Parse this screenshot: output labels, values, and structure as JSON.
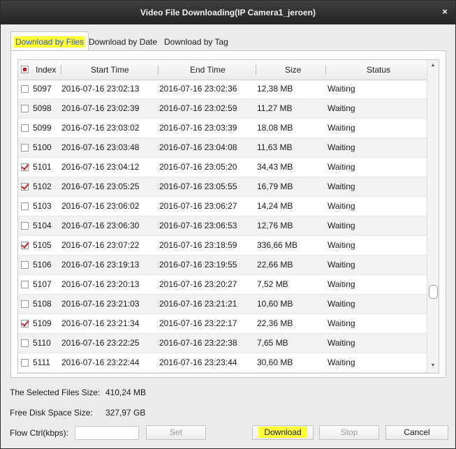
{
  "window": {
    "title": "Video File Downloading(IP Camera1_jeroen)",
    "close_glyph": "×"
  },
  "tabs": [
    {
      "label": "Download by Files",
      "active": true
    },
    {
      "label": "Download by Date",
      "active": false
    },
    {
      "label": "Download by Tag",
      "active": false
    }
  ],
  "table": {
    "columns": [
      "Index",
      "Start Time",
      "End Time",
      "Size",
      "Status"
    ],
    "select_all_state": "partial",
    "rows": [
      {
        "checked": false,
        "index": "5097",
        "start": "2016-07-16 23:02:13",
        "end": "2016-07-16 23:02:36",
        "size": "12,38 MB",
        "status": "Waiting"
      },
      {
        "checked": false,
        "index": "5098",
        "start": "2016-07-16 23:02:39",
        "end": "2016-07-16 23:02:59",
        "size": "11,27 MB",
        "status": "Waiting"
      },
      {
        "checked": false,
        "index": "5099",
        "start": "2016-07-16 23:03:02",
        "end": "2016-07-16 23:03:39",
        "size": "18,08 MB",
        "status": "Waiting"
      },
      {
        "checked": false,
        "index": "5100",
        "start": "2016-07-16 23:03:48",
        "end": "2016-07-16 23:04:08",
        "size": "11,63 MB",
        "status": "Waiting"
      },
      {
        "checked": true,
        "index": "5101",
        "start": "2016-07-16 23:04:12",
        "end": "2016-07-16 23:05:20",
        "size": "34,43 MB",
        "status": "Waiting"
      },
      {
        "checked": true,
        "index": "5102",
        "start": "2016-07-16 23:05:25",
        "end": "2016-07-16 23:05:55",
        "size": "16,79 MB",
        "status": "Waiting"
      },
      {
        "checked": false,
        "index": "5103",
        "start": "2016-07-16 23:06:02",
        "end": "2016-07-16 23:06:27",
        "size": "14,24 MB",
        "status": "Waiting"
      },
      {
        "checked": false,
        "index": "5104",
        "start": "2016-07-16 23:06:30",
        "end": "2016-07-16 23:06:53",
        "size": "12,76 MB",
        "status": "Waiting"
      },
      {
        "checked": true,
        "index": "5105",
        "start": "2016-07-16 23:07:22",
        "end": "2016-07-16 23:18:59",
        "size": "336,66 MB",
        "status": "Waiting"
      },
      {
        "checked": false,
        "index": "5106",
        "start": "2016-07-16 23:19:13",
        "end": "2016-07-16 23:19:55",
        "size": "22,66 MB",
        "status": "Waiting"
      },
      {
        "checked": false,
        "index": "5107",
        "start": "2016-07-16 23:20:13",
        "end": "2016-07-16 23:20:27",
        "size": "7,52 MB",
        "status": "Waiting"
      },
      {
        "checked": false,
        "index": "5108",
        "start": "2016-07-16 23:21:03",
        "end": "2016-07-16 23:21:21",
        "size": "10,60 MB",
        "status": "Waiting"
      },
      {
        "checked": true,
        "index": "5109",
        "start": "2016-07-16 23:21:34",
        "end": "2016-07-16 23:22:17",
        "size": "22,36 MB",
        "status": "Waiting"
      },
      {
        "checked": false,
        "index": "5110",
        "start": "2016-07-16 23:22:25",
        "end": "2016-07-16 23:22:38",
        "size": "7,65 MB",
        "status": "Waiting"
      },
      {
        "checked": false,
        "index": "5111",
        "start": "2016-07-16 23:22:44",
        "end": "2016-07-16 23:23:44",
        "size": "30,60 MB",
        "status": "Waiting"
      }
    ]
  },
  "summary": {
    "selected_label": "The Selected Files Size:",
    "selected_value": "410,24 MB",
    "disk_label": "Free Disk Space Size:",
    "disk_value": "327,97 GB",
    "flow_label": "Flow Ctrl(kbps):",
    "flow_value": ""
  },
  "buttons": {
    "set": "Set",
    "download": "Download",
    "stop": "Stop",
    "cancel": "Cancel"
  },
  "colors": {
    "highlight": "#ffff33",
    "check": "#cc1a1a",
    "active_tab_text": "#3355cc"
  },
  "icons": {
    "scroll_up": "▲",
    "scroll_down": "▼"
  }
}
